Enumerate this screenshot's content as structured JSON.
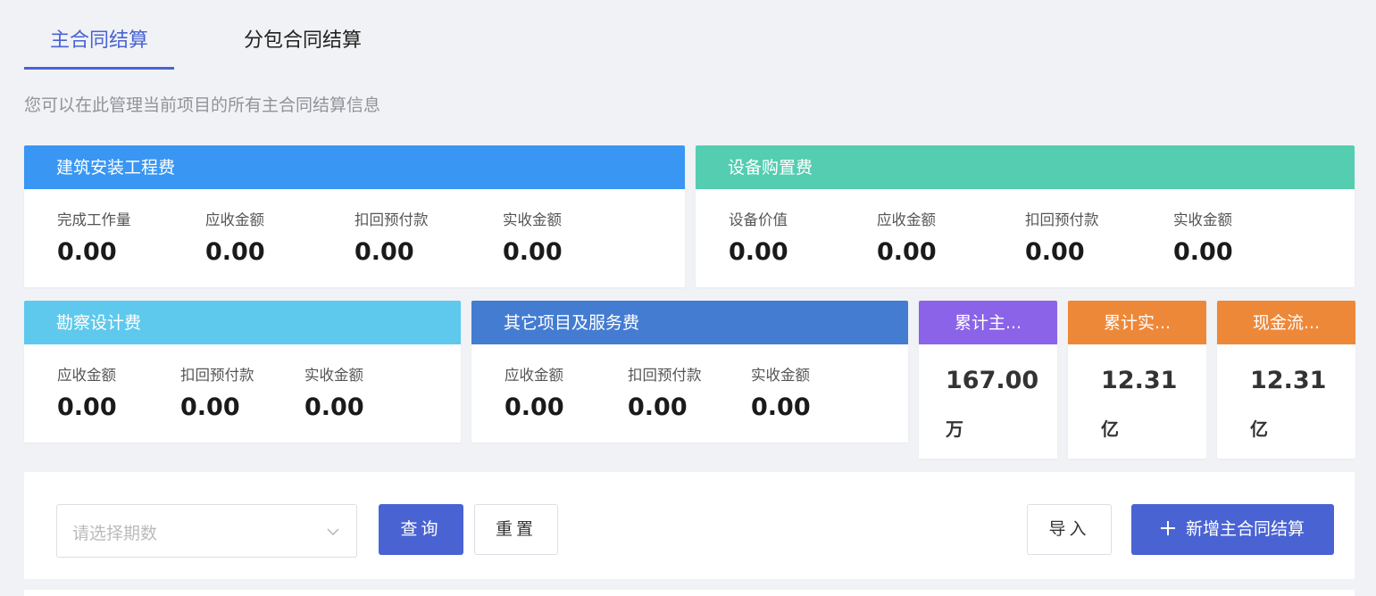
{
  "tabs": [
    {
      "label": "主合同结算",
      "active": true
    },
    {
      "label": "分包合同结算",
      "active": false
    }
  ],
  "subtitle": "您可以在此管理当前项目的所有主合同结算信息",
  "colors": {
    "accent": "#4a63d3",
    "construction": "#3996f3",
    "equipment": "#54cdb1",
    "survey": "#5ec9ed",
    "other": "#447cd2",
    "cumulative_main": "#8b63e8",
    "cumulative_actual": "#ee8839",
    "cash_flow": "#ee8839"
  },
  "cards": {
    "construction": {
      "title": "建筑安装工程费",
      "metrics": [
        {
          "label": "完成工作量",
          "value": "0.00"
        },
        {
          "label": "应收金额",
          "value": "0.00"
        },
        {
          "label": "扣回预付款",
          "value": "0.00"
        },
        {
          "label": "实收金额",
          "value": "0.00"
        }
      ]
    },
    "equipment": {
      "title": "设备购置费",
      "metrics": [
        {
          "label": "设备价值",
          "value": "0.00"
        },
        {
          "label": "应收金额",
          "value": "0.00"
        },
        {
          "label": "扣回预付款",
          "value": "0.00"
        },
        {
          "label": "实收金额",
          "value": "0.00"
        }
      ]
    },
    "survey": {
      "title": "勘察设计费",
      "metrics": [
        {
          "label": "应收金额",
          "value": "0.00"
        },
        {
          "label": "扣回预付款",
          "value": "0.00"
        },
        {
          "label": "实收金额",
          "value": "0.00"
        }
      ]
    },
    "other": {
      "title": "其它项目及服务费",
      "metrics": [
        {
          "label": "应收金额",
          "value": "0.00"
        },
        {
          "label": "扣回预付款",
          "value": "0.00"
        },
        {
          "label": "实收金额",
          "value": "0.00"
        }
      ]
    }
  },
  "summary": [
    {
      "title": "累计主...",
      "value": "167.00",
      "unit": "万"
    },
    {
      "title": "累计实...",
      "value": "12.31",
      "unit": "亿"
    },
    {
      "title": "现金流...",
      "value": "12.31",
      "unit": "亿"
    }
  ],
  "toolbar": {
    "period_placeholder": "请选择期数",
    "query_label": "查询",
    "reset_label": "重置",
    "import_label": "导入",
    "add_label": "新增主合同结算"
  }
}
